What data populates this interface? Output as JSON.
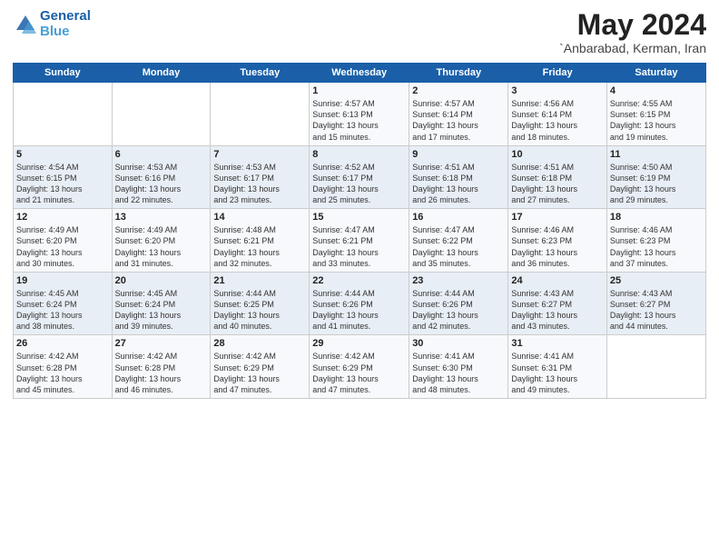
{
  "logo": {
    "line1": "General",
    "line2": "Blue"
  },
  "title": "May 2024",
  "subtitle": "`Anbarabad, Kerman, Iran",
  "days_header": [
    "Sunday",
    "Monday",
    "Tuesday",
    "Wednesday",
    "Thursday",
    "Friday",
    "Saturday"
  ],
  "weeks": [
    [
      {
        "day": "",
        "info": ""
      },
      {
        "day": "",
        "info": ""
      },
      {
        "day": "",
        "info": ""
      },
      {
        "day": "1",
        "info": "Sunrise: 4:57 AM\nSunset: 6:13 PM\nDaylight: 13 hours\nand 15 minutes."
      },
      {
        "day": "2",
        "info": "Sunrise: 4:57 AM\nSunset: 6:14 PM\nDaylight: 13 hours\nand 17 minutes."
      },
      {
        "day": "3",
        "info": "Sunrise: 4:56 AM\nSunset: 6:14 PM\nDaylight: 13 hours\nand 18 minutes."
      },
      {
        "day": "4",
        "info": "Sunrise: 4:55 AM\nSunset: 6:15 PM\nDaylight: 13 hours\nand 19 minutes."
      }
    ],
    [
      {
        "day": "5",
        "info": "Sunrise: 4:54 AM\nSunset: 6:15 PM\nDaylight: 13 hours\nand 21 minutes."
      },
      {
        "day": "6",
        "info": "Sunrise: 4:53 AM\nSunset: 6:16 PM\nDaylight: 13 hours\nand 22 minutes."
      },
      {
        "day": "7",
        "info": "Sunrise: 4:53 AM\nSunset: 6:17 PM\nDaylight: 13 hours\nand 23 minutes."
      },
      {
        "day": "8",
        "info": "Sunrise: 4:52 AM\nSunset: 6:17 PM\nDaylight: 13 hours\nand 25 minutes."
      },
      {
        "day": "9",
        "info": "Sunrise: 4:51 AM\nSunset: 6:18 PM\nDaylight: 13 hours\nand 26 minutes."
      },
      {
        "day": "10",
        "info": "Sunrise: 4:51 AM\nSunset: 6:18 PM\nDaylight: 13 hours\nand 27 minutes."
      },
      {
        "day": "11",
        "info": "Sunrise: 4:50 AM\nSunset: 6:19 PM\nDaylight: 13 hours\nand 29 minutes."
      }
    ],
    [
      {
        "day": "12",
        "info": "Sunrise: 4:49 AM\nSunset: 6:20 PM\nDaylight: 13 hours\nand 30 minutes."
      },
      {
        "day": "13",
        "info": "Sunrise: 4:49 AM\nSunset: 6:20 PM\nDaylight: 13 hours\nand 31 minutes."
      },
      {
        "day": "14",
        "info": "Sunrise: 4:48 AM\nSunset: 6:21 PM\nDaylight: 13 hours\nand 32 minutes."
      },
      {
        "day": "15",
        "info": "Sunrise: 4:47 AM\nSunset: 6:21 PM\nDaylight: 13 hours\nand 33 minutes."
      },
      {
        "day": "16",
        "info": "Sunrise: 4:47 AM\nSunset: 6:22 PM\nDaylight: 13 hours\nand 35 minutes."
      },
      {
        "day": "17",
        "info": "Sunrise: 4:46 AM\nSunset: 6:23 PM\nDaylight: 13 hours\nand 36 minutes."
      },
      {
        "day": "18",
        "info": "Sunrise: 4:46 AM\nSunset: 6:23 PM\nDaylight: 13 hours\nand 37 minutes."
      }
    ],
    [
      {
        "day": "19",
        "info": "Sunrise: 4:45 AM\nSunset: 6:24 PM\nDaylight: 13 hours\nand 38 minutes."
      },
      {
        "day": "20",
        "info": "Sunrise: 4:45 AM\nSunset: 6:24 PM\nDaylight: 13 hours\nand 39 minutes."
      },
      {
        "day": "21",
        "info": "Sunrise: 4:44 AM\nSunset: 6:25 PM\nDaylight: 13 hours\nand 40 minutes."
      },
      {
        "day": "22",
        "info": "Sunrise: 4:44 AM\nSunset: 6:26 PM\nDaylight: 13 hours\nand 41 minutes."
      },
      {
        "day": "23",
        "info": "Sunrise: 4:44 AM\nSunset: 6:26 PM\nDaylight: 13 hours\nand 42 minutes."
      },
      {
        "day": "24",
        "info": "Sunrise: 4:43 AM\nSunset: 6:27 PM\nDaylight: 13 hours\nand 43 minutes."
      },
      {
        "day": "25",
        "info": "Sunrise: 4:43 AM\nSunset: 6:27 PM\nDaylight: 13 hours\nand 44 minutes."
      }
    ],
    [
      {
        "day": "26",
        "info": "Sunrise: 4:42 AM\nSunset: 6:28 PM\nDaylight: 13 hours\nand 45 minutes."
      },
      {
        "day": "27",
        "info": "Sunrise: 4:42 AM\nSunset: 6:28 PM\nDaylight: 13 hours\nand 46 minutes."
      },
      {
        "day": "28",
        "info": "Sunrise: 4:42 AM\nSunset: 6:29 PM\nDaylight: 13 hours\nand 47 minutes."
      },
      {
        "day": "29",
        "info": "Sunrise: 4:42 AM\nSunset: 6:29 PM\nDaylight: 13 hours\nand 47 minutes."
      },
      {
        "day": "30",
        "info": "Sunrise: 4:41 AM\nSunset: 6:30 PM\nDaylight: 13 hours\nand 48 minutes."
      },
      {
        "day": "31",
        "info": "Sunrise: 4:41 AM\nSunset: 6:31 PM\nDaylight: 13 hours\nand 49 minutes."
      },
      {
        "day": "",
        "info": ""
      }
    ]
  ]
}
